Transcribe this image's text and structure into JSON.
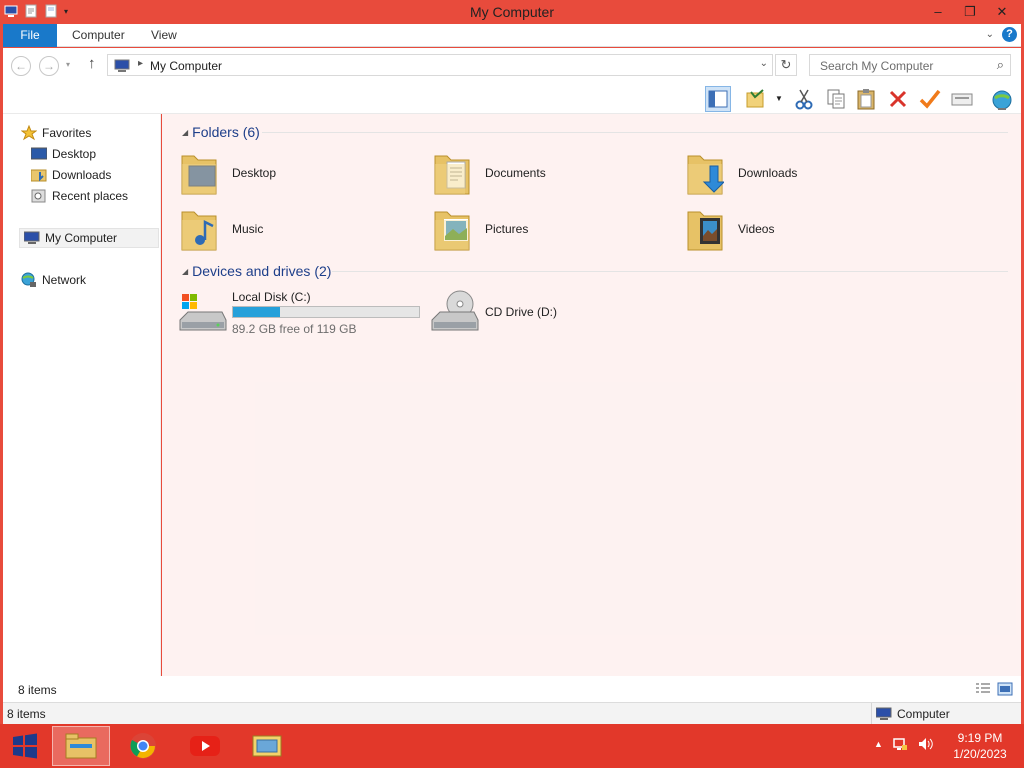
{
  "window": {
    "title": "My Computer",
    "accent": "#e84b3c",
    "controls": {
      "minimize": "–",
      "restore": "❐",
      "close": "✕"
    }
  },
  "ribbon": {
    "tabs": [
      {
        "label": "File"
      },
      {
        "label": "Computer"
      },
      {
        "label": "View"
      }
    ],
    "help": "?",
    "file_color": "#1979ca"
  },
  "address": {
    "path": "My Computer",
    "search_placeholder": "Search My Computer"
  },
  "toolbar": {
    "icons": [
      "layout-pane-icon",
      "properties-icon",
      "cut-icon",
      "copy-icon",
      "paste-icon",
      "delete-icon",
      "rename-check-icon",
      "drive-map-icon",
      "network-globe-icon"
    ]
  },
  "navigation": {
    "favorites": "Favorites",
    "favorites_items": [
      {
        "label": "Desktop"
      },
      {
        "label": "Downloads"
      },
      {
        "label": "Recent places"
      }
    ],
    "computer": "My Computer",
    "network": "Network"
  },
  "content": {
    "folders_header": "Folders (6)",
    "folders": [
      {
        "label": "Desktop"
      },
      {
        "label": "Documents"
      },
      {
        "label": "Downloads"
      },
      {
        "label": "Music"
      },
      {
        "label": "Pictures"
      },
      {
        "label": "Videos"
      }
    ],
    "drives_header": "Devices and drives (2)",
    "drives": [
      {
        "label": "Local Disk (C:)",
        "free": "89.2 GB free of 119 GB",
        "used_fraction": 0.25
      },
      {
        "label": "CD Drive (D:)"
      }
    ]
  },
  "footer": {
    "item_count": "8 items"
  },
  "status": {
    "left": "8 items",
    "right": "Computer"
  },
  "taskbar": {
    "apps": [
      "file-explorer-icon",
      "chrome-icon",
      "youtube-icon",
      "window-app-icon"
    ],
    "time": "9:19 PM",
    "date": "1/20/2023"
  }
}
